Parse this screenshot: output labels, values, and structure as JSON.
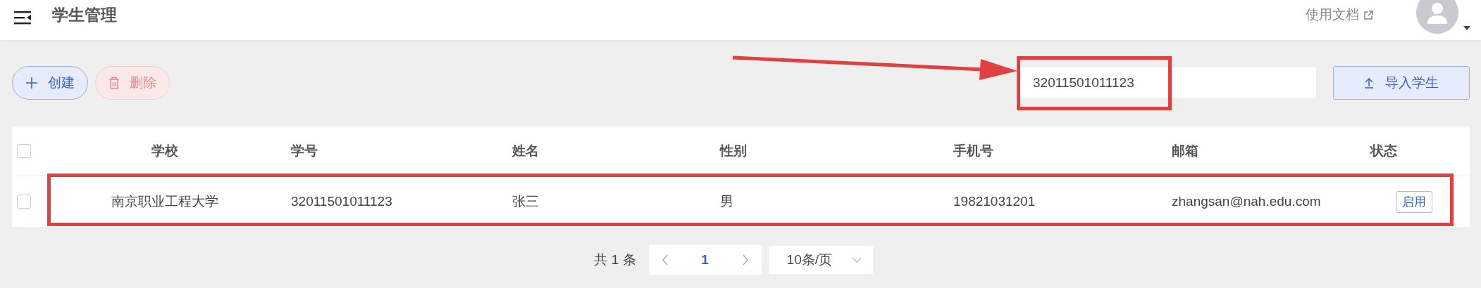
{
  "header": {
    "title": "学生管理",
    "docs_link": "使用文档"
  },
  "toolbar": {
    "buttons": [
      {
        "kind": "create",
        "label": "创建",
        "disabled": false
      },
      {
        "kind": "delete",
        "label": "删除",
        "disabled": true
      }
    ],
    "search": {
      "value": "32011501011123",
      "highlighted": true
    },
    "import_button": "导入学生"
  },
  "annotation_arrow": true,
  "table": {
    "all_checked": false,
    "columns": [
      "学校",
      "学号",
      "姓名",
      "性别",
      "手机号",
      "邮箱",
      "状态"
    ],
    "rows": [
      {
        "checked": false,
        "highlighted": true,
        "cells": [
          "南京职业工程大学",
          "32011501011123",
          "张三",
          "男",
          "19821031201",
          "zhangsan@nah.edu.com"
        ],
        "status": "启用"
      }
    ]
  },
  "pagination": {
    "total": "共 1 条",
    "pages": [
      {
        "label": "1",
        "selected": true
      }
    ],
    "page_size": "10条/页"
  }
}
